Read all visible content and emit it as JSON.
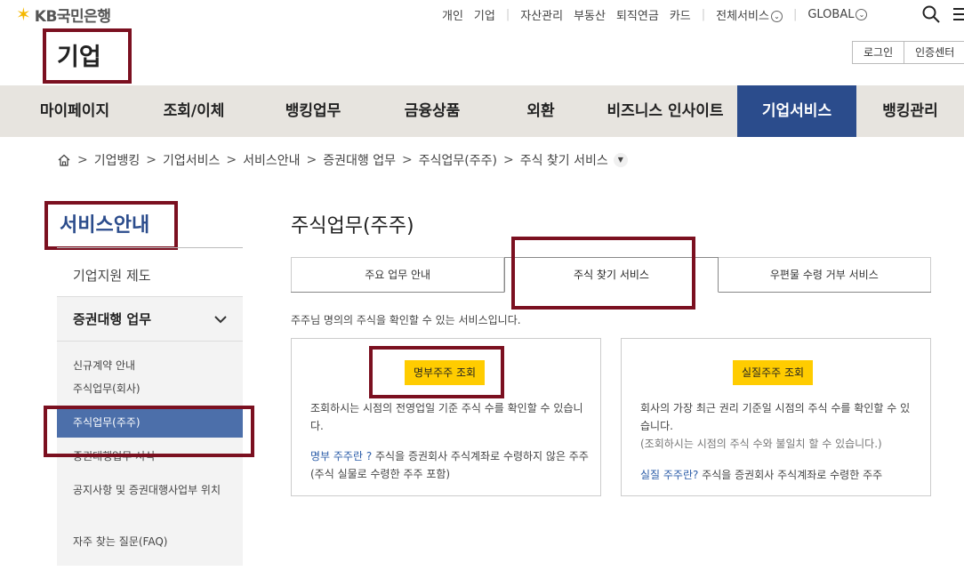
{
  "header": {
    "logo_text": "KB국민은행",
    "logo_icon": "kb-star-icon",
    "top_links": [
      "개인",
      "기업",
      "자산관리",
      "부동산",
      "퇴직연금",
      "카드"
    ],
    "all_services": "전체서비스",
    "global": "GLOBAL",
    "page_title": "기업",
    "login_label": "로그인",
    "cert_label": "인증센터"
  },
  "gnb": {
    "items": [
      "마이페이지",
      "조회/이체",
      "뱅킹업무",
      "금융상품",
      "외환",
      "비즈니스 인사이트",
      "기업서비스",
      "뱅킹관리"
    ],
    "active": "기업서비스"
  },
  "breadcrumb": {
    "items": [
      "기업뱅킹",
      "기업서비스",
      "서비스안내",
      "증권대행 업무",
      "주식업무(주주)",
      "주식 찾기 서비스"
    ]
  },
  "sidebar": {
    "title": "서비스안내",
    "item1": "기업지원 제도",
    "group_label": "증권대행 업무",
    "sub_items": [
      "신규계약 안내",
      "주식업무(회사)",
      "주식업무(주주)",
      "증권대행업무 서식",
      "공지사항 및 증권대행사업부 위치",
      "자주 찾는 질문(FAQ)"
    ],
    "active_sub": "주식업무(주주)"
  },
  "content": {
    "title": "주식업무(주주)",
    "tabs": [
      "주요 업무 안내",
      "주식 찾기 서비스",
      "우편물 수령 거부 서비스"
    ],
    "active_tab": "주식 찾기 서비스",
    "intro": "주주님 명의의 주식을 확인할 수 있는 서비스입니다.",
    "card1": {
      "button": "명부주주 조회",
      "desc": "조회하시는 시점의 전영업일 기준 주식 수를 확인할 수 있습니다.",
      "link_text": "명부 주주란 ?",
      "link_desc": " 주식을 증권회사 주식계좌로 수령하지 않은 주주 (주식 실물로 수령한 주주 포함)"
    },
    "card2": {
      "button": "실질주주 조회",
      "desc": "회사의 가장 최근 권리 기준일 시점의 주식 수를 확인할 수 있습니다.",
      "note": "(조회하시는 시점의 주식 수와 불일치 할 수 있습니다.)",
      "link_text": "실질 주주란?",
      "link_desc": " 주식을 증권회사 주식계좌로 수령한 주주"
    }
  },
  "colors": {
    "brand_blue": "#2b4c8c",
    "accent_yellow": "#ffcc00",
    "highlight_box": "#7b1020"
  }
}
